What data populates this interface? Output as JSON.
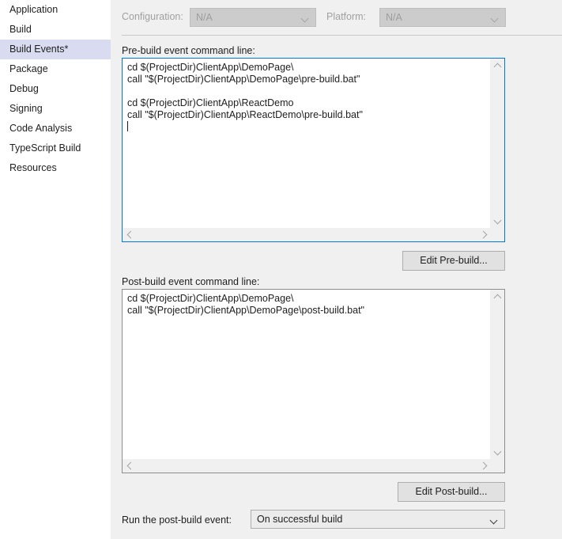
{
  "sidebar": {
    "items": [
      {
        "label": "Application",
        "selected": false
      },
      {
        "label": "Build",
        "selected": false
      },
      {
        "label": "Build Events*",
        "selected": true
      },
      {
        "label": "Package",
        "selected": false
      },
      {
        "label": "Debug",
        "selected": false
      },
      {
        "label": "Signing",
        "selected": false
      },
      {
        "label": "Code Analysis",
        "selected": false
      },
      {
        "label": "TypeScript Build",
        "selected": false
      },
      {
        "label": "Resources",
        "selected": false
      }
    ]
  },
  "config_row": {
    "configuration_label": "Configuration:",
    "configuration_value": "N/A",
    "platform_label": "Platform:",
    "platform_value": "N/A"
  },
  "prebuild": {
    "label": "Pre-build event command line:",
    "value": "cd $(ProjectDir)ClientApp\\DemoPage\\\ncall \"$(ProjectDir)ClientApp\\DemoPage\\pre-build.bat\"\n\ncd $(ProjectDir)ClientApp\\ReactDemo\ncall \"$(ProjectDir)ClientApp\\ReactDemo\\pre-build.bat\"\n",
    "edit_button_label": "Edit Pre-build..."
  },
  "postbuild": {
    "label": "Post-build event command line:",
    "value": "cd $(ProjectDir)ClientApp\\DemoPage\\\ncall \"$(ProjectDir)ClientApp\\DemoPage\\post-build.bat\"",
    "edit_button_label": "Edit Post-build..."
  },
  "run_event": {
    "label": "Run the post-build event:",
    "value": "On successful build"
  },
  "colors": {
    "selected_item": "#d9dcf0",
    "focus_border": "#0078d7",
    "panel_background": "#f0f0f0",
    "disabled_text": "#a0a0a0"
  }
}
